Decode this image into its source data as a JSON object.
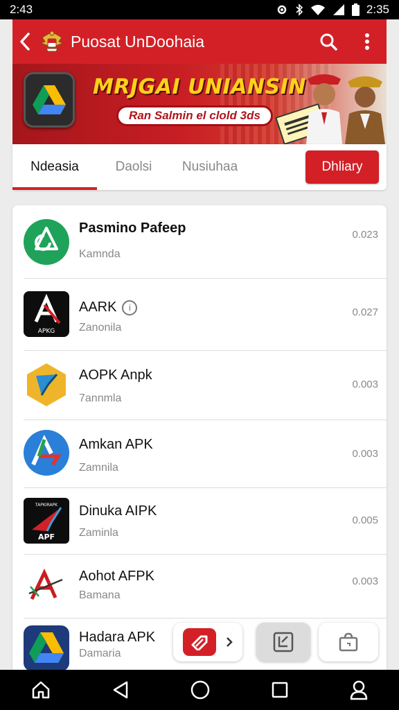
{
  "status": {
    "time_left": "2:43",
    "time_right": "2:35"
  },
  "appbar": {
    "title": "Puosat UnDoohaia",
    "back_icon": "arrow-left-icon",
    "emblem_icon": "garuda-emblem-icon",
    "search_icon": "search-icon",
    "menu_icon": "more-vert-icon"
  },
  "banner": {
    "headline": "MRJGAI UNIANSIN",
    "pill": "Ran Salmin el clold 3ds"
  },
  "tabs": {
    "items": [
      "Ndeasia",
      "Daolsi",
      "Nusiuhaa"
    ],
    "active_index": 0,
    "primary_label": "Dhliary"
  },
  "apps": [
    {
      "name": "Pasmino Pafeep",
      "sub": "Kamnda",
      "size": "0.023"
    },
    {
      "name": "AARK",
      "sub": "Zanonila",
      "size": "0.027",
      "info": "i"
    },
    {
      "name": "AOPK Anpk",
      "sub": "7annmla",
      "size": "0.003"
    },
    {
      "name": "Amkan APK",
      "sub": "Zamnila",
      "size": "0.003"
    },
    {
      "name": "Dinuka AIPK",
      "sub": "Zaminla",
      "size": "0.005"
    },
    {
      "name": "Aohot AFPK",
      "sub": "Bamana",
      "size": "0.003"
    },
    {
      "name": "Hadara APK",
      "sub": "Damaria",
      "size": ""
    }
  ],
  "icon_labels": {
    "aark": "APKG",
    "dinuka_top": "TAPKIRAPK",
    "dinuka_bottom": "APF"
  },
  "colors": {
    "primary": "#d32027",
    "banner_text": "#ffd21a"
  }
}
